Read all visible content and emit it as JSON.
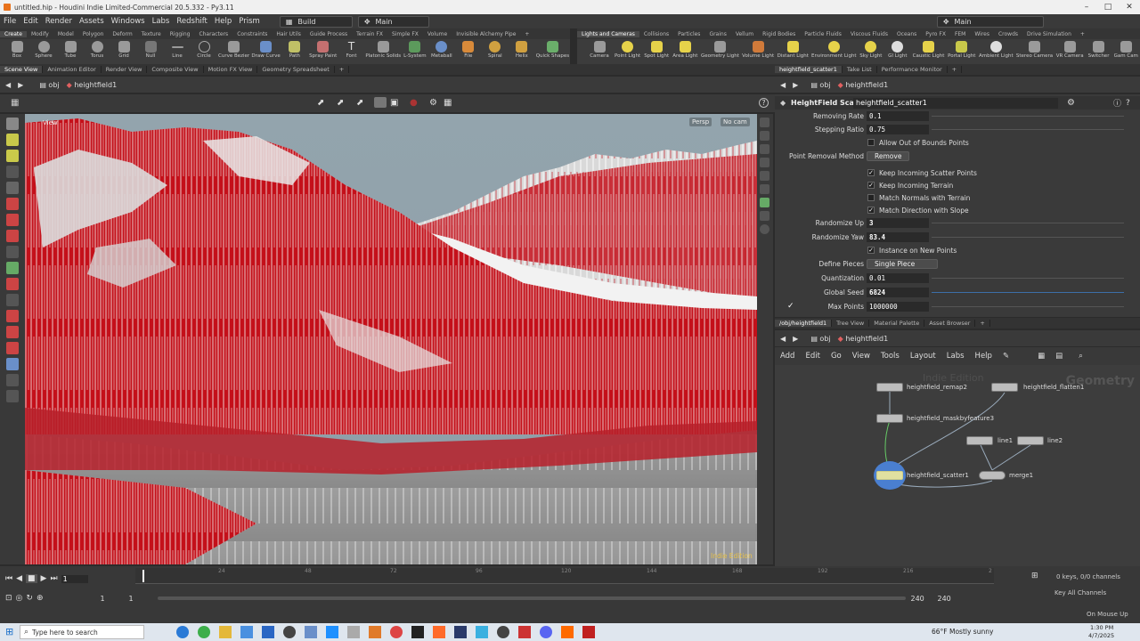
{
  "window": {
    "title": "untitled.hip - Houdini Indie Limited-Commercial 20.5.332 - Py3.11"
  },
  "menubar": {
    "items": [
      "File",
      "Edit",
      "Render",
      "Assets",
      "Windows",
      "Labs",
      "Redshift",
      "Help",
      "Prism"
    ],
    "desktop": "Build",
    "main": "Main",
    "main2": "Main"
  },
  "shelf_left": {
    "tabs": [
      "Create",
      "Modify",
      "Model",
      "Polygon",
      "Deform",
      "Texture",
      "Rigging",
      "Characters",
      "Constraints",
      "Hair Utils",
      "Guide Process",
      "Terrain FX",
      "Simple FX",
      "Volume",
      "Invisible Alchemy Pipe"
    ],
    "tools": [
      "Box",
      "Sphere",
      "Tube",
      "Torus",
      "Grid",
      "Null",
      "Line",
      "Circle",
      "Curve Bezier",
      "Draw Curve",
      "Path",
      "Spray Paint",
      "Font",
      "Platonic Solids",
      "L-System",
      "Metaball",
      "File",
      "Spiral",
      "Helix",
      "Quick Shapes"
    ]
  },
  "shelf_right": {
    "tabs": [
      "Lights and Cameras",
      "Collisions",
      "Particles",
      "Grains",
      "Vellum",
      "Rigid Bodies",
      "Particle Fluids",
      "Viscous Fluids",
      "Oceans",
      "Pyro FX",
      "FEM",
      "Wires",
      "Crowds",
      "Drive Simulation"
    ],
    "tools": [
      "Camera",
      "Point Light",
      "Spot Light",
      "Area Light",
      "Geometry Light",
      "Volume Light",
      "Distant Light",
      "Environment Light",
      "Sky Light",
      "GI Light",
      "Caustic Light",
      "Portal Light",
      "Ambient Light",
      "Stereo Camera",
      "VR Camera",
      "Switcher",
      "Gam Cam"
    ]
  },
  "left_tabs": [
    "Scene View",
    "Animation Editor",
    "Render View",
    "Composite View",
    "Motion FX View",
    "Geometry Spreadsheet"
  ],
  "left_path": {
    "obj": "obj",
    "node": "heightfield1"
  },
  "viewport": {
    "persp": "Persp",
    "cam": "No cam",
    "watermark": "Indie Edition",
    "view_label": "View"
  },
  "right_tabs": [
    "heightfield_scatter1",
    "Take List",
    "Performance Monitor"
  ],
  "right_path": {
    "obj": "obj",
    "node": "heightfield1"
  },
  "params": {
    "node_type": "HeightField Scatter",
    "node_name": "heightfield_scatter1",
    "removing_rate": {
      "label": "Removing Rate",
      "value": "0.1"
    },
    "stepping_ratio": {
      "label": "Stepping Ratio",
      "value": "0.75"
    },
    "allow_oob": {
      "label": "Allow Out of Bounds Points",
      "checked": false
    },
    "point_removal": {
      "label": "Point Removal Method",
      "value": "Remove"
    },
    "keep_scatter": {
      "label": "Keep Incoming Scatter Points",
      "checked": true
    },
    "keep_terrain": {
      "label": "Keep Incoming Terrain",
      "checked": true
    },
    "match_normals": {
      "label": "Match Normals with Terrain",
      "checked": false
    },
    "match_dir": {
      "label": "Match Direction with Slope",
      "checked": true
    },
    "rand_up": {
      "label": "Randomize Up",
      "value": "3"
    },
    "rand_yaw": {
      "label": "Randomize Yaw",
      "value": "83.4"
    },
    "instance_new": {
      "label": "Instance on New Points",
      "checked": true
    },
    "define_pieces": {
      "label": "Define Pieces",
      "value": "Single Piece"
    },
    "quantization": {
      "label": "Quantization",
      "value": "0.01"
    },
    "global_seed": {
      "label": "Global Seed",
      "value": "6824"
    },
    "max_points": {
      "label": "Max Points",
      "value": "1000000"
    }
  },
  "net_tabs": [
    "/obj/heightfield1",
    "Tree View",
    "Material Palette",
    "Asset Browser"
  ],
  "net_path": {
    "obj": "obj",
    "node": "heightfield1"
  },
  "net_menu": [
    "Add",
    "Edit",
    "Go",
    "View",
    "Tools",
    "Layout",
    "Labs",
    "Help"
  ],
  "network": {
    "context": "Geometry",
    "edition": "Indie Edition",
    "nodes": [
      "heightfield_remap2",
      "heightfield_flatten1",
      "heightfield_maskbyfeature3",
      "line1",
      "line2",
      "heightfield_scatter1",
      "merge1"
    ]
  },
  "timeline": {
    "ticks": [
      "24",
      "48",
      "72",
      "96",
      "120",
      "144",
      "168",
      "192",
      "216",
      "2"
    ],
    "current_frame": "1",
    "start": "1",
    "start2": "1",
    "end": "240",
    "end2": "240",
    "keys": "0 keys, 0/0 channels",
    "key_all": "Key All Channels",
    "on_mouse_up": "On Mouse Up"
  },
  "taskbar": {
    "search": "Type here to search",
    "weather": "66°F  Mostly sunny",
    "time": "1:30 PM",
    "date": "4/7/2025"
  }
}
